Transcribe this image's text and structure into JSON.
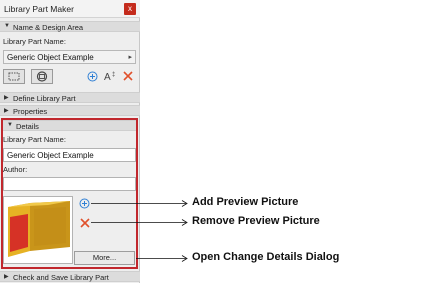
{
  "window": {
    "title": "Library Part Maker",
    "close_label": "x"
  },
  "sections": {
    "name_design": "Name & Design Area",
    "define": "Define Library Part",
    "properties": "Properties",
    "details": "Details",
    "check_save": "Check and Save Library Part"
  },
  "name_design": {
    "name_label": "Library Part Name:",
    "name_value": "Generic Object Example"
  },
  "details": {
    "name_label": "Library Part Name:",
    "name_value": "Generic Object Example",
    "author_label": "Author:",
    "author_value": "",
    "more_button": "More..."
  },
  "callouts": {
    "add_preview": "Add Preview Picture",
    "remove_preview": "Remove Preview Picture",
    "open_dialog": "Open Change Details Dialog"
  },
  "colors": {
    "highlight_frame": "#c1272d",
    "close_button": "#c42b1c",
    "add_icon": "#2f7fd4",
    "remove_icon": "#e0502b",
    "preview_body": "#e6b224",
    "preview_panel": "#d63226"
  },
  "icons": {
    "section_expanded": "triangle-down",
    "section_collapsed": "triangle-right",
    "dropdown": "triangle-right",
    "tools": [
      "select-rectangle-icon",
      "zoom-view-icon",
      "add-circle-icon",
      "text-size-icon",
      "delete-x-icon"
    ]
  }
}
